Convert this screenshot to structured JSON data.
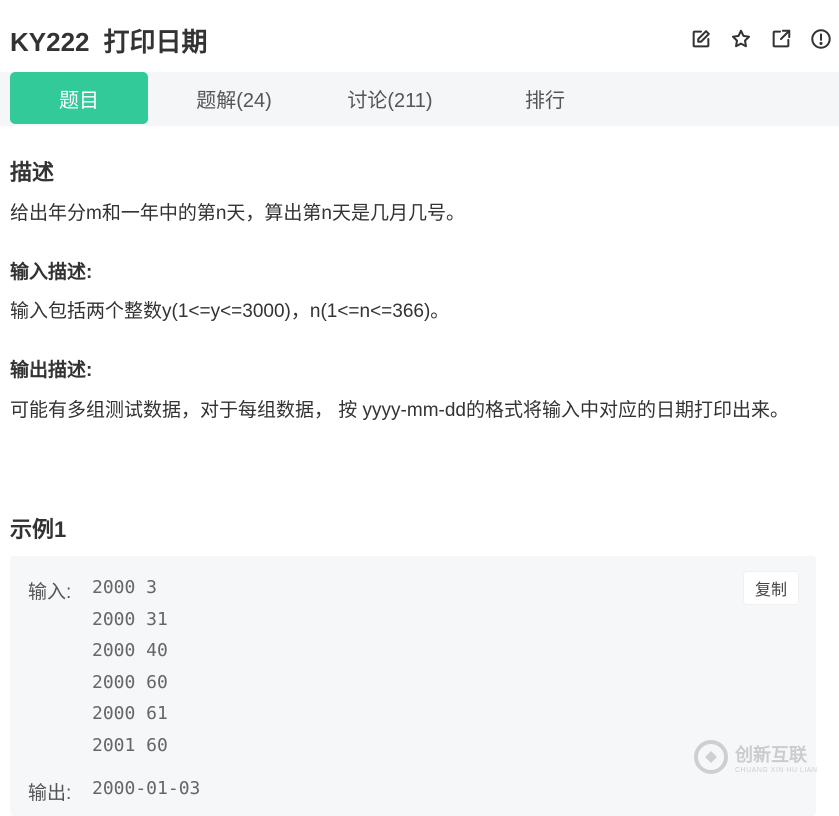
{
  "header": {
    "problem_code": "KY222",
    "problem_title": "打印日期",
    "actions": [
      "edit-icon",
      "star-icon",
      "external-link-icon",
      "info-icon"
    ]
  },
  "tabs": [
    {
      "label": "题目",
      "active": true
    },
    {
      "label": "题解(24)",
      "active": false
    },
    {
      "label": "讨论(211)",
      "active": false
    },
    {
      "label": "排行",
      "active": false
    }
  ],
  "description": {
    "heading": "描述",
    "text": "给出年分m和一年中的第n天，算出第n天是几月几号。"
  },
  "input_desc": {
    "heading": "输入描述:",
    "text": "输入包括两个整数y(1<=y<=3000)，n(1<=n<=366)。"
  },
  "output_desc": {
    "heading": "输出描述:",
    "text": "可能有多组测试数据，对于每组数据， 按 yyyy-mm-dd的格式将输入中对应的日期打印出来。"
  },
  "example": {
    "heading": "示例1",
    "input_label": "输入:",
    "input_lines": [
      "2000 3",
      "2000 31",
      "2000 40",
      "2000 60",
      "2000 61",
      "2001 60"
    ],
    "output_label": "输出:",
    "output_lines": [
      "2000-01-03"
    ],
    "copy_label": "复制"
  },
  "watermark": {
    "text": "创新互联",
    "subtext": "CHUANG XIN HU LIAN"
  },
  "colors": {
    "accent": "#32ca99",
    "tab_bar_bg": "#f4f6f8",
    "example_bg": "#f5f7f9"
  }
}
